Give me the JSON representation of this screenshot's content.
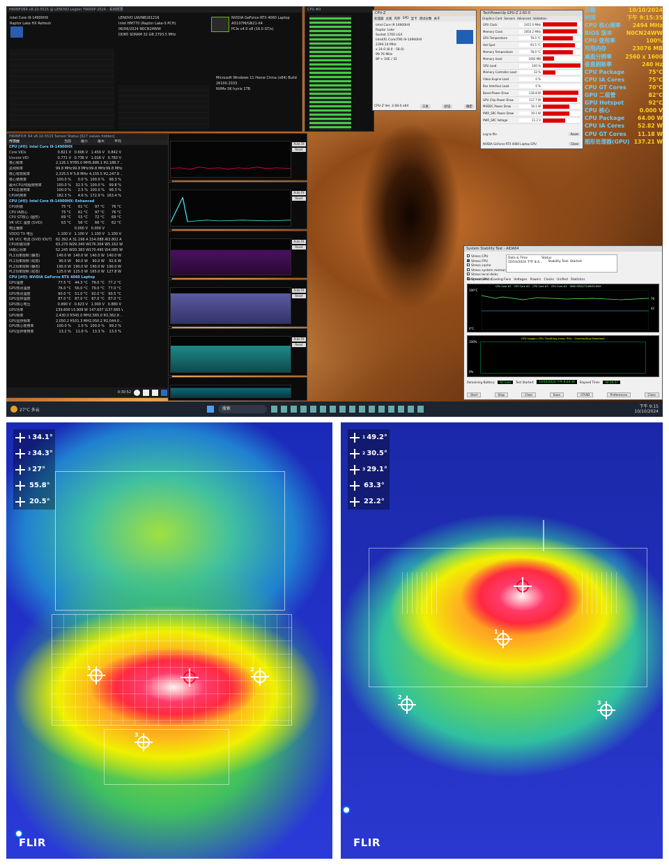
{
  "cpuz_mini": {
    "title": "HWiNFO64 v8.10-5515 @ LENOVO Legion Y9000P 2024 - 系统概要",
    "cpu_name": "Intel Core i9-14900HX",
    "platform": "Raptor Lake HX Refresh",
    "mb": "LENOVO LNVNB161216",
    "chipset": "Intel HM770 (Raptor Lake-S PCH)",
    "bios_date": "06/06/2024",
    "bios_ver": "N0CN24WW",
    "gpu_name": "NVIDIA GeForce RTX 4060 Laptop",
    "gpu_chip": "AD107M/GN21-X4",
    "gpu_bus": "PCIe v4.0 x8 (16.0 GT/s)",
    "mem_type": "DDR5 SDRAM",
    "mem_size": "32 GB",
    "mem_freq": "2793.5 MHz",
    "os": "Microsoft Windows 11 Home China (x64) Build 26100.2033",
    "drive": "NVMe SK hynix 1TB"
  },
  "cpuz_window": {
    "title": "CPU-Z",
    "tabs": [
      "处理器",
      "主板",
      "内存",
      "SPD",
      "显卡",
      "测试分数",
      "关于"
    ],
    "name": "Intel Core i9 14900HX",
    "codename": "Raptor Lake",
    "package": "Socket 1700 LGA",
    "spec": "Intel(R) Core(TM) i9-14900HX",
    "core_speed": "2394.14 MHz",
    "multiplier": "x 24.0 (8.0 - 58.0)",
    "bus_speed": "99.76 MHz",
    "cores": "8P + 16E",
    "threads": "32",
    "version": "CPU-Z Ver. 2.08.0.x64",
    "btn_tools": "工具",
    "btn_verify": "验证",
    "btn_ok": "确定"
  },
  "gpuz": {
    "title": "TechPowerUp GPU-Z 2.60.0",
    "tabs": [
      "Graphics Card",
      "Sensors",
      "Advanced",
      "Validation"
    ],
    "sensors": [
      {
        "label": "GPU Clock",
        "value": "2415.0 MHz",
        "fill": 0.9
      },
      {
        "label": "Memory Clock",
        "value": "2050.2 MHz",
        "fill": 0.9
      },
      {
        "label": "GPU Temperature",
        "value": "79.0 °C",
        "fill": 0.8
      },
      {
        "label": "Hot Spot",
        "value": "93.5 °C",
        "fill": 0.85
      },
      {
        "label": "Memory Temperature",
        "value": "78.0 °C",
        "fill": 0.8
      },
      {
        "label": "Memory Used",
        "value": "1092 MB",
        "fill": 0.3
      },
      {
        "label": "GPU Load",
        "value": "100 %",
        "fill": 1.0
      },
      {
        "label": "Memory Controller Load",
        "value": "33 %",
        "fill": 0.33
      },
      {
        "label": "Video Engine Load",
        "value": "0 %",
        "fill": 0
      },
      {
        "label": "Bus Interface Load",
        "value": "0 %",
        "fill": 0
      },
      {
        "label": "Board Power Draw",
        "value": "136.8 W",
        "fill": 0.95
      },
      {
        "label": "GPU Chip Power Draw",
        "value": "117.7 W",
        "fill": 0.9
      },
      {
        "label": "MVDDC Power Draw",
        "value": "16.1 W",
        "fill": 0.7
      },
      {
        "label": "PWR_SRC Power Draw",
        "value": "19.1 W",
        "fill": 0.7
      },
      {
        "label": "PWR_SRC Voltage",
        "value": "11.2 V",
        "fill": 0.6
      }
    ],
    "log": "Log to file",
    "reset": "Reset",
    "card": "NVIDIA GeForce RTX 4060 Laptop GPU",
    "close": "Close"
  },
  "overlay": [
    {
      "label": "日期",
      "value": "10/10/2024"
    },
    {
      "label": "时间",
      "value": "下午 9:15:35"
    },
    {
      "label": "CPU 核心频率",
      "value": "2494 MHz"
    },
    {
      "label": "BIOS 版本",
      "value": "N0CN24WW"
    },
    {
      "label": "CPU 使用率",
      "value": "100%"
    },
    {
      "label": "可用内存",
      "value": "23076 MB"
    },
    {
      "label": "桌面分辨率",
      "value": "2560 x 1600"
    },
    {
      "label": "垂直刷新率",
      "value": "240 Hz"
    },
    {
      "label": "CPU Package",
      "value": "75°C"
    },
    {
      "label": "CPU IA Cores",
      "value": "75°C"
    },
    {
      "label": "CPU GT Cores",
      "value": "70°C"
    },
    {
      "label": "GPU 二极管",
      "value": "82°C"
    },
    {
      "label": "GPU Hotspot",
      "value": "92°C"
    },
    {
      "label": "CPU 核心",
      "value": "0.000 V"
    },
    {
      "label": "CPU Package",
      "value": "64.00 W"
    },
    {
      "label": "CPU IA Cores",
      "value": "52.82 W"
    },
    {
      "label": "CPU GT Cores",
      "value": "11.18 W"
    },
    {
      "label": "图形处理器(GPU)",
      "value": "137.21 W"
    }
  ],
  "hwinfo": {
    "title": "HWiNFO® 64 v8.10-5515 Sensor Status [627 values hidden]",
    "headers": [
      "传感器",
      "当前",
      "最小",
      "最大",
      "平均"
    ],
    "rows": [
      {
        "s": "CPU [#0]: Intel Core i9-14900HX",
        "sec": true
      },
      {
        "s": "Core VIDs",
        "v": [
          "0.821 V",
          "0.606 V",
          "1.459 V",
          "0.842 V"
        ]
      },
      {
        "s": "Uncore VID",
        "v": [
          "0.771 V",
          "0.736 V",
          "1.016 V",
          "0.783 V"
        ]
      },
      {
        "s": "核心频率",
        "v": [
          "2,126.1 MHz",
          "785.0 MHz",
          "5,686.1 M...",
          "2,188.7 ..."
        ]
      },
      {
        "s": "总线频率",
        "v": [
          "99.8 MHz",
          "99.8 MHz",
          "99.8 MHz",
          "99.8 MHz"
        ]
      },
      {
        "s": "核心有效频率",
        "v": [
          "2,225.5 MHz",
          "5.8 MHz",
          "4,155.5 M...",
          "2,247.8 ..."
        ]
      },
      {
        "s": "核心使用率",
        "v": [
          "100.0 %",
          "0.0 %",
          "100.0 %",
          "98.3 %"
        ]
      },
      {
        "s": "最大CPU/线程使用率",
        "v": [
          "100.0 %",
          "32.5 %",
          "100.0 %",
          "99.8 %"
        ]
      },
      {
        "s": "CPU总使用率",
        "v": [
          "100.0 %",
          "2.5 %",
          "100.0 %",
          "98.3 %"
        ]
      },
      {
        "s": "CPU利用率",
        "v": [
          "182.3 %",
          "4.6 %",
          "172.9 %",
          "163.4 %"
        ]
      },
      {
        "s": "CPU [#0]: Intel Core i9-14900HX: Enhanced",
        "sec": true
      },
      {
        "s": "CPU封装",
        "v": [
          "75 °C",
          "61 °C",
          "97 °C",
          "76 °C"
        ]
      },
      {
        "s": "CPU IA核心",
        "v": [
          "75 °C",
          "61 °C",
          "97 °C",
          "76 °C"
        ]
      },
      {
        "s": "CPU GT核心 (图形)",
        "v": [
          "69 °C",
          "53 °C",
          "72 °C",
          "69 °C"
        ]
      },
      {
        "s": "VR VCC 温度 (SVID)",
        "v": [
          "63 °C",
          "56 °C",
          "66 °C",
          "62 °C"
        ]
      },
      {
        "s": "电压偏移",
        "v": [
          "",
          "0.000 V",
          "0.000 V",
          ""
        ]
      },
      {
        "s": "VDDQ TX 电压",
        "v": [
          "1.100 V",
          "1.100 V",
          "1.100 V",
          "1.100 V"
        ]
      },
      {
        "s": "VR VCC 电流 (SVID IOUT)",
        "v": [
          "62.392 A",
          "31.196 A",
          "154.088 A",
          "63.802 A"
        ]
      },
      {
        "s": "CPU封装功率",
        "v": [
          "63.270 W",
          "29.340 W",
          "176.304 W",
          "65.162 W"
        ]
      },
      {
        "s": "IA核心功率",
        "v": [
          "52.245 W",
          "20.383 W",
          "170.495 W",
          "54.085 W"
        ]
      },
      {
        "s": "PL1功率限制 (静态)",
        "v": [
          "140.0 W",
          "140.0 W",
          "140.0 W",
          "140.0 W"
        ]
      },
      {
        "s": "PL1功率限制 (动态)",
        "v": [
          "90.0 W",
          "90.0 W",
          "90.0 W",
          "92.6 W"
        ]
      },
      {
        "s": "PL2功率限制 (静态)",
        "v": [
          "190.0 W",
          "190.0 W",
          "190.0 W",
          "190.0 W"
        ]
      },
      {
        "s": "PL2功率限制 (动态)",
        "v": [
          "125.0 W",
          "125.0 W",
          "165.0 W",
          "127.8 W"
        ]
      },
      {
        "s": "CPU [#0]: NVIDIA GeForce RTX 4060 Laptop",
        "sec": true
      },
      {
        "s": "GPU温度",
        "v": [
          "77.5 °C",
          "44.3 °C",
          "79.0 °C",
          "77.2 °C"
        ]
      },
      {
        "s": "GPU热点温度",
        "v": [
          "76.0 °C",
          "56.0 °C",
          "79.0 °C",
          "77.0 °C"
        ]
      },
      {
        "s": "GPU热点温度",
        "v": [
          "90.0 °C",
          "51.0 °C",
          "92.0 °C",
          "90.5 °C"
        ]
      },
      {
        "s": "GPU显存温度",
        "v": [
          "87.0 °C",
          "87.0 °C",
          "87.0 °C",
          "87.0 °C"
        ]
      },
      {
        "s": "GPU核心电压",
        "v": [
          "0.890 V",
          "0.623 V",
          "1.000 V",
          "0.880 V"
        ]
      },
      {
        "s": "GPU功率",
        "v": [
          "139.600 W",
          "5.909 W",
          "147.607 W",
          "137.665 W"
        ]
      },
      {
        "s": "GPU频率",
        "v": [
          "2,430.0 MHz",
          "345.0 MHz",
          "2,565.0 M...",
          "2,362.8 ..."
        ]
      },
      {
        "s": "GPU显存频率",
        "v": [
          "2,050.2 MHz",
          "101.3 MHz",
          "2,050.2 M...",
          "2,044.0 ..."
        ]
      },
      {
        "s": "GPU核心使用率",
        "v": [
          "100.0 %",
          "1.0 %",
          "100.0 %",
          "99.2 %"
        ]
      },
      {
        "s": "GPU显存使用率",
        "v": [
          "13.2 %",
          "11.6 %",
          "13.3 %",
          "13.0 %"
        ]
      }
    ],
    "timer": "0:30:52"
  },
  "aida": {
    "title": "System Stability Test - AIDA64",
    "checks": [
      "Stress CPU",
      "Stress FPU",
      "Stress cache",
      "Stress system memory",
      "Stress local disks",
      "Stress GPU(s)"
    ],
    "date_label": "Date & Time",
    "status_label": "Status",
    "date_value": "10/10/2024 下午 8:4...",
    "status_value": "Stability Test: Started",
    "tabs": [
      "Temperatures",
      "Cooling Fans",
      "Voltages",
      "Powers",
      "Clocks",
      "Unified",
      "Statistics"
    ],
    "legend": [
      "CPU Core #1",
      "CPU Core #2",
      "CPU Core #3",
      "CPU Core #4",
      "UMIS RPJYJ1T24MLR1HWY"
    ],
    "chart_top": "100°C",
    "chart_bot": "0°C",
    "t1": "76",
    "t2": "42",
    "usage_title": "CPU Usage | CPU Throttling (max: 9%) - Overheating Detected!",
    "usage_top": "100%",
    "usage_bot": "0%",
    "battery_label": "Remaining Battery:",
    "battery": "AC Line",
    "started_label": "Test Started:",
    "started": "10/10/2024 下午 8:44:39",
    "elapsed_label": "Elapsed Time:",
    "elapsed": "00:30:57",
    "buttons": [
      "Start",
      "Stop",
      "Clear",
      "Save",
      "CPUID",
      "Preferences",
      "Close"
    ]
  },
  "taskbar": {
    "weather": "27°C 多云",
    "search": "搜索",
    "time": "下午 9:15",
    "date": "10/10/2024"
  },
  "thermal_left": {
    "readouts": [
      {
        "n": "1",
        "t": "34.1"
      },
      {
        "n": "2",
        "t": "34.3"
      },
      {
        "n": "3",
        "t": "27"
      },
      {
        "n": "hot",
        "t": "55.8"
      },
      {
        "n": "cold",
        "t": "20.5"
      }
    ],
    "spots": [
      "1",
      "2",
      "3"
    ],
    "brand": "FLIR"
  },
  "thermal_right": {
    "readouts": [
      {
        "n": "1",
        "t": "49.2"
      },
      {
        "n": "2",
        "t": "30.5"
      },
      {
        "n": "3",
        "t": "29.1"
      },
      {
        "n": "hot",
        "t": "63.3"
      },
      {
        "n": "cold",
        "t": "22.2"
      }
    ],
    "spots": [
      "1",
      "2",
      "3"
    ],
    "brand": "FLIR"
  },
  "colors": {
    "hot": "#e8203c",
    "cold": "#1e3cd2",
    "accent": "#ffd21a"
  }
}
